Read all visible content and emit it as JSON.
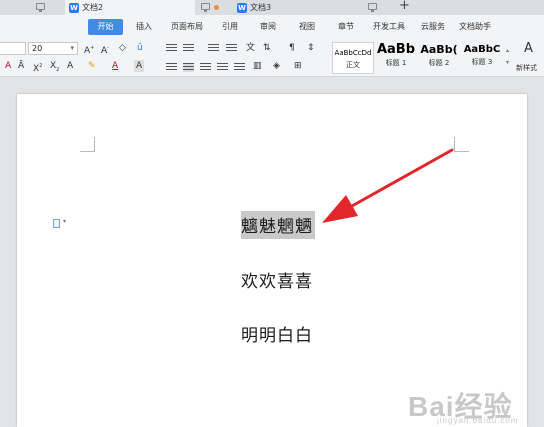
{
  "tabs": [
    {
      "label": "文档2",
      "active": true
    },
    {
      "label": "文档3",
      "active": false
    }
  ],
  "menu": {
    "active": "开始",
    "items": [
      "插入",
      "页面布局",
      "引用",
      "审阅",
      "视图",
      "章节",
      "开发工具",
      "云服务",
      "文档助手"
    ]
  },
  "ribbon": {
    "font_size": "20",
    "styles": [
      {
        "sample": "AaBbCcDd",
        "name": "正文"
      },
      {
        "sample": "AaBb",
        "name": "标题 1"
      },
      {
        "sample": "AaBb(",
        "name": "标题 2"
      },
      {
        "sample": "AaBbC",
        "name": "标题 3"
      }
    ],
    "new_style_label": "新样式"
  },
  "document": {
    "lines": [
      "魑魅魍魉",
      "欢欢喜喜",
      "明明白白"
    ],
    "selected_line_index": 0
  },
  "watermark": {
    "text": "Bai经验",
    "sub": "jingyan.baidu.com"
  },
  "colors": {
    "accent": "#3f8ce6",
    "annotation_arrow": "#e3262b",
    "selection": "#c9c9c9"
  }
}
